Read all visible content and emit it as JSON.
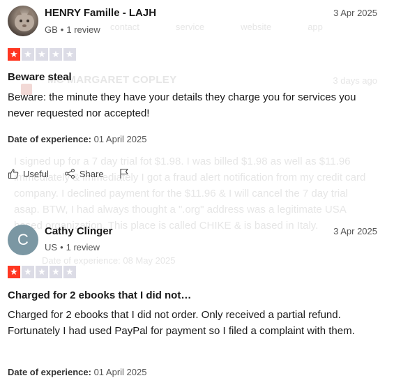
{
  "background_ghost": {
    "nav": [
      "contact",
      "service",
      "website",
      "app"
    ],
    "name": "MC   MARGARET COPLEY",
    "date": "3 days ago",
    "body": "I signed up for a 7 day trial fot $1.98. I was billed $1.98 as well as $11.96 immediately & immediately I got a fraud alert notification from my credit card company. I declined payment for the $11.96 & I will cancel the 7 day trial asap. BTW, I had always thought a \".org\" address was a legitimate USA based organization. This place is called CHIKE & is based in Italy.",
    "exp": "Date of experience: 08 May 2025"
  },
  "reviews": [
    {
      "name": "HENRY Famille - LAJH",
      "country": "GB",
      "review_count": "1 review",
      "date": "3 Apr 2025",
      "rating": 1,
      "title": "Beware steal",
      "body": "Beware: the minute they have your details they charge you for services you never requested nor accepted!",
      "exp_label": "Date of experience:",
      "exp_date": "01 April 2025",
      "actions": {
        "useful": "Useful",
        "share": "Share"
      }
    },
    {
      "name": "Cathy Clinger",
      "avatar_letter": "C",
      "country": "US",
      "review_count": "1 review",
      "date": "3 Apr 2025",
      "rating": 1,
      "title": "Charged for 2 ebooks that I did not…",
      "body": "Charged for 2 ebooks that I did not order. Only received a partial refund. Fortunately I had used PayPal for payment so I filed a complaint with them.",
      "exp_label": "Date of experience:",
      "exp_date": "01 April 2025"
    }
  ],
  "colors": {
    "star_filled": "#ff3722",
    "star_empty": "#dcdce6",
    "avatar_c": "#7b97a3"
  }
}
